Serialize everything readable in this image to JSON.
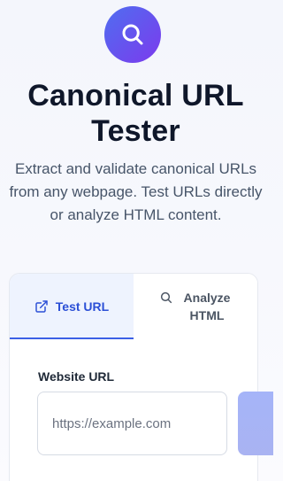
{
  "header": {
    "logo_icon": "search-icon",
    "title": "Canonical URL Tester",
    "subtitle": "Extract and validate canonical URLs from any webpage. Test URLs directly or analyze HTML content."
  },
  "tabs": [
    {
      "label": "Test URL",
      "icon": "external-link-icon",
      "active": true
    },
    {
      "label": "Analyze HTML",
      "icon": "search-icon",
      "active": false
    }
  ],
  "form": {
    "url_label": "Website URL",
    "url_placeholder": "https://example.com",
    "url_value": ""
  },
  "colors": {
    "accent": "#3b5fe6",
    "logo_gradient_start": "#4f6ef0",
    "logo_gradient_end": "#7c3aed",
    "button_disabled": "#a5b4f8"
  }
}
